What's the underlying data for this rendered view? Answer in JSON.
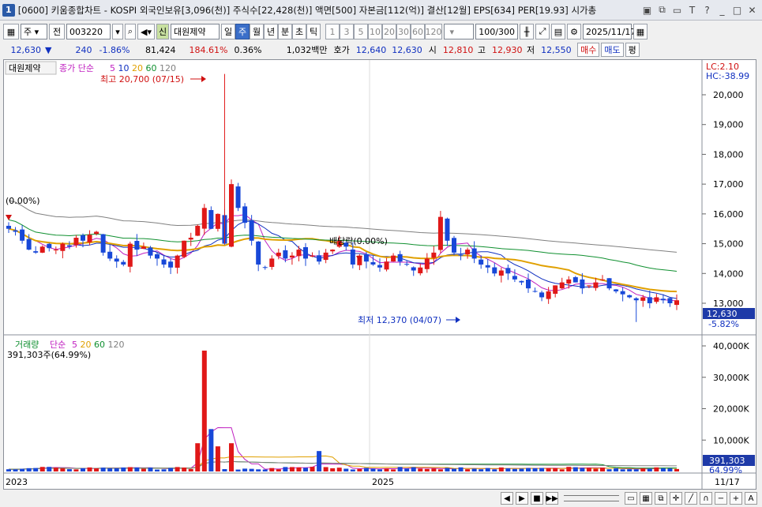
{
  "window": {
    "number": "1",
    "title": "[0600] 키움종합차트 - KOSPI 외국인보유[3,096(천)] 주식수[22,428(천)] 액면[500] 자본금[112(억)] 결산[12월] EPS[634] PER[19.93] 시가총"
  },
  "toolbar": {
    "type_select": "주",
    "prev_label": "전",
    "code": "003220",
    "badge": "신",
    "stock_name": "대원제약",
    "periods": [
      "일",
      "주",
      "월",
      "년",
      "분",
      "초",
      "틱"
    ],
    "active_period": "주",
    "minute_units": [
      "1",
      "3",
      "5",
      "10",
      "20",
      "30",
      "60",
      "120"
    ],
    "count": "100/300",
    "date": "2025/11/17"
  },
  "quote": {
    "price": "12,630",
    "arrow": "▼",
    "change": "240",
    "change_pct": "-1.86%",
    "volume": "81,424",
    "vol_ratio": "184.61%",
    "turnover_pct": "0.36%",
    "amount": "1,032백만",
    "ask_label": "호가",
    "ask": "12,640",
    "bid": "12,630",
    "open_label": "시",
    "open": "12,810",
    "high_label": "고",
    "high": "12,930",
    "low_label": "저",
    "low": "12,550",
    "buy_label": "매수",
    "sell_label": "매도",
    "eval_label": "평"
  },
  "chart_data": {
    "type": "line",
    "legend": {
      "name": "대원제약",
      "ma_label": "종가 단순",
      "ma_periods": [
        "5",
        "10",
        "20",
        "60",
        "120"
      ],
      "ma_colors": [
        "#c020c0",
        "#1030c0",
        "#e0a000",
        "#109030",
        "#808080"
      ]
    },
    "price_axis": {
      "ticks": [
        "20,000",
        "19,000",
        "18,000",
        "17,000",
        "16,000",
        "15,000",
        "14,000",
        "13,000"
      ],
      "ylim": [
        12000,
        21000
      ]
    },
    "volume_axis": {
      "ticks": [
        "40,000K",
        "30,000K",
        "20,000K",
        "10,000K"
      ],
      "ylim": [
        0,
        40000
      ]
    },
    "last_price": {
      "value": "12,630",
      "pct": "-5.82%"
    },
    "lc_label": "LC:2.10",
    "hc_label": "HC:-38.99",
    "annotations": {
      "high": "최고 20,700 (07/15)",
      "low": "최저 12,370 (04/07)",
      "start_pct": "(0.00%)",
      "dividend": "배당락(0.00%)"
    },
    "volume_legend": {
      "label": "거래량",
      "ma_label": "단순",
      "periods": [
        "5",
        "20",
        "60",
        "120"
      ]
    },
    "volume_readout": "391,303주(64.99%)",
    "last_volume": {
      "value": "391,303",
      "pct": "64.99%"
    },
    "x_labels": [
      "2023",
      "2025",
      "11/17"
    ],
    "closes": [
      15500,
      15400,
      15100,
      14800,
      14700,
      14900,
      14850,
      14800,
      15000,
      14900,
      15200,
      15100,
      15300,
      15400,
      14700,
      14500,
      14400,
      14300,
      15000,
      14800,
      14900,
      14600,
      14500,
      14300,
      14200,
      14600,
      15100,
      15200,
      15600,
      16200,
      15500,
      16000,
      15000,
      17000,
      16200,
      15700,
      15100,
      14300,
      14200,
      14500,
      14700,
      14500,
      14600,
      14800,
      14500,
      14600,
      14400,
      14700,
      14800,
      15100,
      14900,
      14300,
      14600,
      14400,
      14300,
      14200,
      14400,
      14600,
      14400,
      14300,
      14100,
      14200,
      14500,
      14700,
      15900,
      15100,
      14700,
      14600,
      14800,
      14500,
      14300,
      14200,
      14000,
      14100,
      14000,
      13800,
      13700,
      13500,
      13400,
      13200,
      13400,
      13600,
      13700,
      13800,
      13700,
      13500,
      13600,
      13700,
      13800,
      13500,
      13400,
      13300,
      13200,
      13100,
      13200,
      13000,
      13200,
      13100,
      13000,
      13100
    ]
  },
  "status": {
    "buttons": [
      "⏴",
      "⏵",
      "⏹",
      "⏵⏵"
    ]
  }
}
